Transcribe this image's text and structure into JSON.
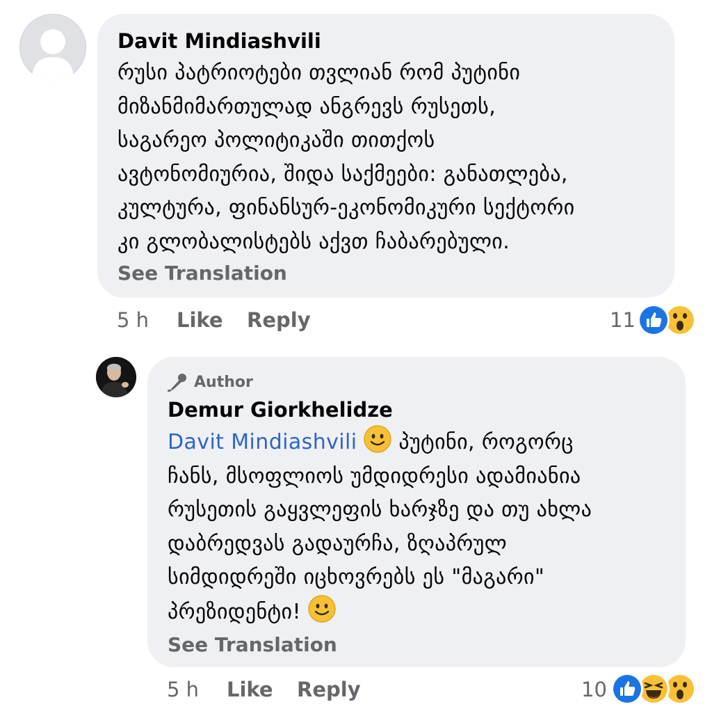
{
  "comments": [
    {
      "author": "Davit Mindiashvili",
      "lines": [
        "რუსი პატრიოტები თვლიან რომ პუტინი",
        "მიზანმიმართულად ანგრევს რუსეთს,",
        "საგარეო პოლიტიკაში თითქოს",
        "ავტონომიურია, შიდა საქმეები: განათლება,",
        "კულტურა, ფინანსურ-ეკონომიკური სექტორი",
        "კი გლობალისტებს აქვთ ჩაბარებული."
      ],
      "see_translation": "See Translation",
      "time": "5 h",
      "like_label": "Like",
      "reply_label": "Reply",
      "reaction_count": "11",
      "reactions": [
        "like-icon",
        "wow-icon"
      ]
    },
    {
      "badge": "Author",
      "author": "Demur Giorkhelidze",
      "mention": "Davit Mindiashvili",
      "first_line": "პუტინი, როგორც",
      "lines": [
        "ჩანს, მსოფლიოს უმდიდრესი ადამიანია",
        "რუსეთის გაყვლეფის ხარჯზე და თუ ახლა",
        "დაბრედვას გადაურჩა, ზღაპრულ",
        "სიმდიდრეში იცხოვრებს ეს \"მაგარი\""
      ],
      "last_line": "პრეზიდენტი!",
      "see_translation": "See Translation",
      "time": "5 h",
      "like_label": "Like",
      "reply_label": "Reply",
      "reaction_count": "10",
      "reactions": [
        "like-icon",
        "haha-icon",
        "wow-icon"
      ]
    }
  ],
  "colors": {
    "bubble": "#eff0f3",
    "secondary_text": "#65676b",
    "mention": "#2f65c4",
    "like_blue": "#1b74e4",
    "emoji_yellow": "#f7c137"
  }
}
